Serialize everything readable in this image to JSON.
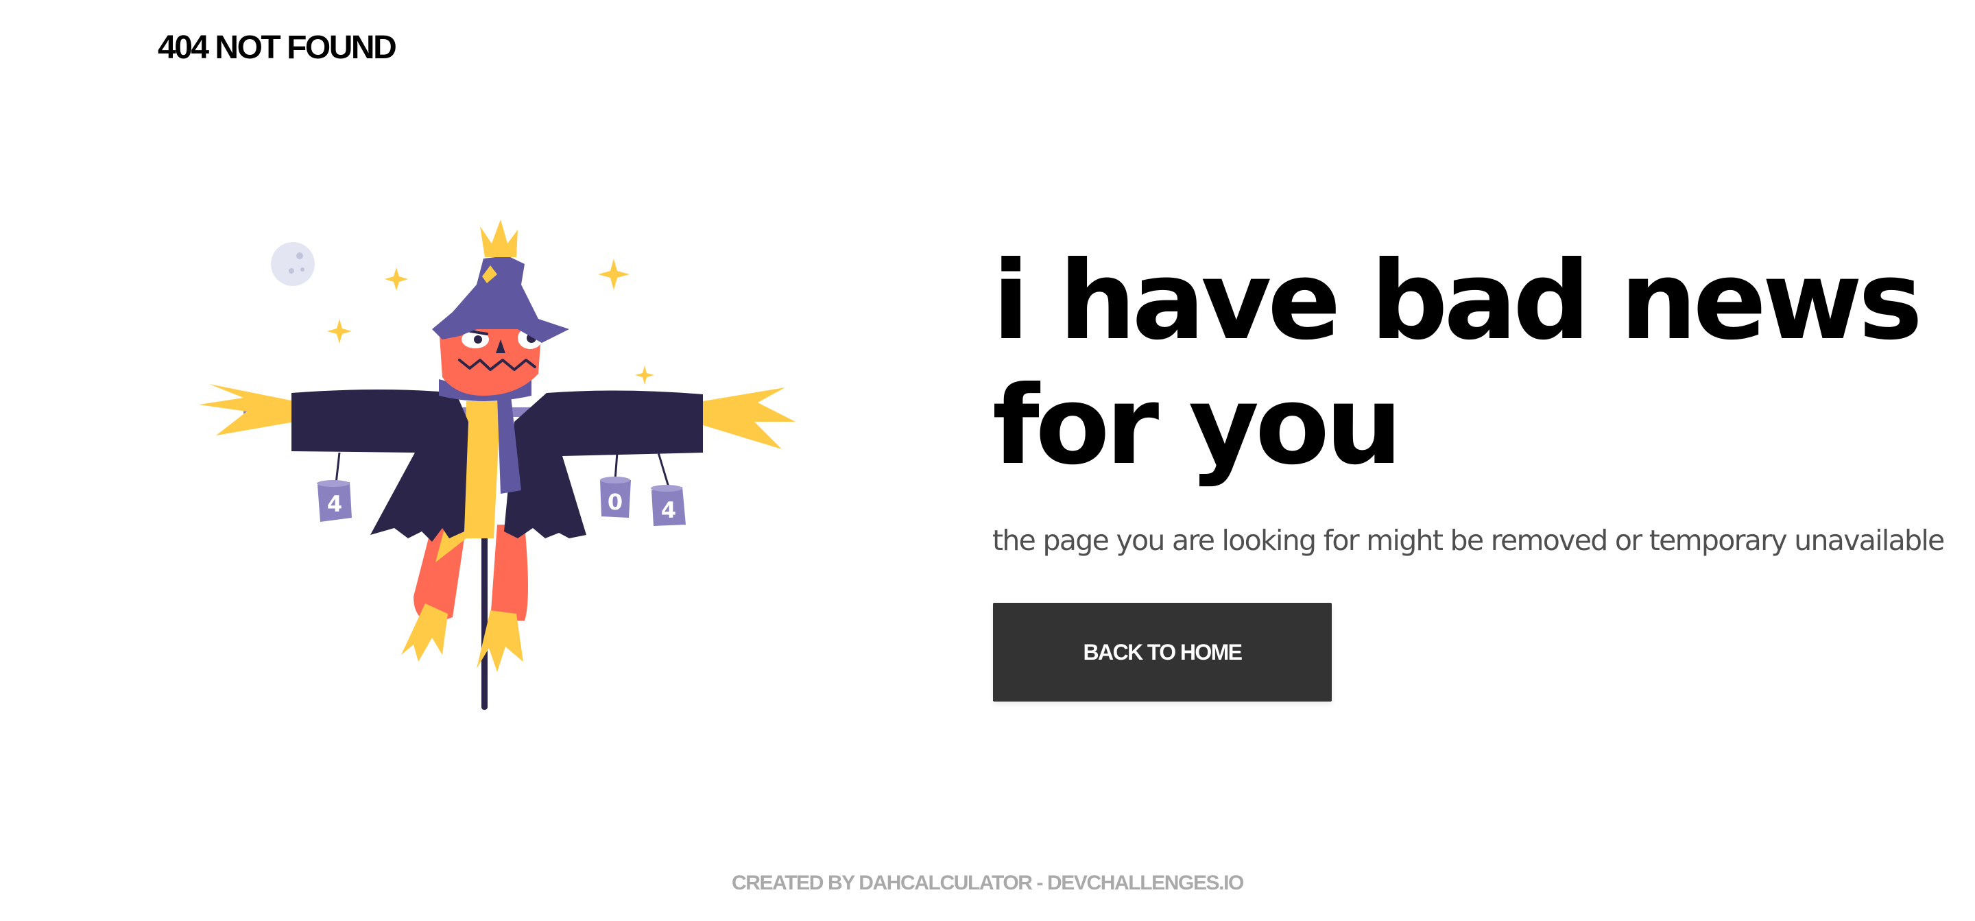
{
  "header": {
    "brand": "404 NOT FOUND"
  },
  "hero": {
    "headline": "i have bad news for you",
    "subtitle": "the page you are looking for might be removed or temporary unavailable",
    "button_label": "BACK TO HOME"
  },
  "illustration": {
    "can_labels": [
      "4",
      "0",
      "4"
    ]
  },
  "footer": {
    "credit": "CREATED BY DAHCALCULATOR - DEVCHALLENGES.IO"
  },
  "colors": {
    "background": "#ffffff",
    "text_primary": "#000000",
    "text_secondary": "#4f4f4f",
    "button_bg": "#333333",
    "button_text": "#ffffff",
    "footer_text": "#a9a9a9",
    "coat": "#2b2549",
    "hat": "#5f57a0",
    "face": "#ff6a55",
    "straw": "#ffcb47",
    "cans": "#8a82c0"
  }
}
